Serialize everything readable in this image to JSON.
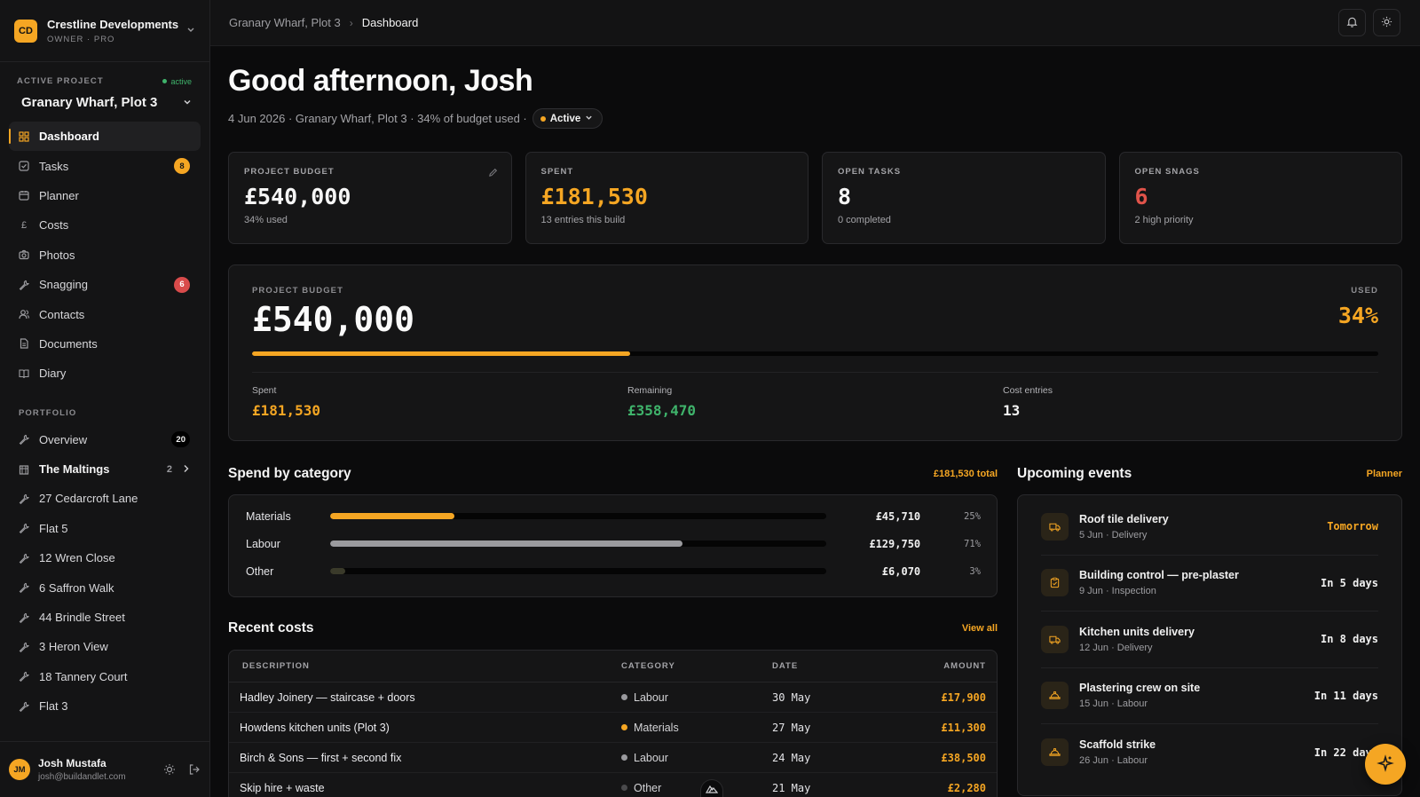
{
  "org": {
    "initials": "CD",
    "name": "Crestline Developments",
    "role": "OWNER · PRO"
  },
  "project": {
    "section_label": "ACTIVE PROJECT",
    "status": "active",
    "name": "Granary Wharf, Plot 3"
  },
  "nav": [
    {
      "label": "Dashboard",
      "icon": "grid-icon"
    },
    {
      "label": "Tasks",
      "icon": "checkbox-icon",
      "badge": "8"
    },
    {
      "label": "Planner",
      "icon": "calendar-icon"
    },
    {
      "label": "Costs",
      "icon": "pound-icon"
    },
    {
      "label": "Photos",
      "icon": "camera-icon"
    },
    {
      "label": "Snagging",
      "icon": "wrench-icon",
      "badge": "6"
    },
    {
      "label": "Contacts",
      "icon": "contacts-icon"
    },
    {
      "label": "Documents",
      "icon": "document-icon"
    },
    {
      "label": "Diary",
      "icon": "book-icon"
    }
  ],
  "portfolio": {
    "label": "PORTFOLIO",
    "overview": {
      "label": "Overview",
      "badge": "20"
    },
    "group": {
      "label": "The Maltings",
      "count": "2"
    },
    "items": [
      "27 Cedarcroft Lane",
      "Flat 5",
      "12 Wren Close",
      "6 Saffron Walk",
      "44 Brindle Street",
      "3 Heron View",
      "18 Tannery Court",
      "Flat 3"
    ]
  },
  "user": {
    "initials": "JM",
    "name": "Josh Mustafa",
    "email": "josh@buildandlet.com"
  },
  "breadcrumb": {
    "parent": "Granary Wharf, Plot 3",
    "current": "Dashboard"
  },
  "header": {
    "greeting": "Good afternoon, Josh",
    "subline": "4 Jun 2026 · Granary Wharf, Plot 3 · 34% of budget used ·",
    "status": "Active"
  },
  "stats": [
    {
      "label": "PROJECT BUDGET",
      "value": "£540,000",
      "sub": "34% used"
    },
    {
      "label": "SPENT",
      "value": "£181,530",
      "sub": "13 entries this build"
    },
    {
      "label": "OPEN TASKS",
      "value": "8",
      "sub": "0 completed"
    },
    {
      "label": "OPEN SNAGS",
      "value": "6",
      "sub": "2 high priority"
    }
  ],
  "budget": {
    "label": "PROJECT BUDGET",
    "value": "£540,000",
    "used_label": "USED",
    "used_pct": "34%",
    "used_fraction": 0.336,
    "spent_label": "Spent",
    "spent": "£181,530",
    "remaining_label": "Remaining",
    "remaining": "£358,470",
    "entries_label": "Cost entries",
    "entries": "13"
  },
  "spend": {
    "title": "Spend by category",
    "total": "£181,530 total",
    "rows": [
      {
        "name": "Materials",
        "amount": "£45,710",
        "pct": "25%",
        "fraction": 0.25,
        "color": "#f5a623"
      },
      {
        "name": "Labour",
        "amount": "£129,750",
        "pct": "71%",
        "fraction": 0.71,
        "color": "#9a9a9e"
      },
      {
        "name": "Other",
        "amount": "£6,070",
        "pct": "3%",
        "fraction": 0.03,
        "color": "#3a3a2a"
      }
    ]
  },
  "costs": {
    "title": "Recent costs",
    "view_all": "View all",
    "headers": [
      "DESCRIPTION",
      "CATEGORY",
      "DATE",
      "AMOUNT"
    ],
    "rows": [
      {
        "desc": "Hadley Joinery — staircase + doors",
        "cat": "Labour",
        "cat_color": "#9a9a9e",
        "date": "30 May",
        "amount": "£17,900"
      },
      {
        "desc": "Howdens kitchen units (Plot 3)",
        "cat": "Materials",
        "cat_color": "#f5a623",
        "date": "27 May",
        "amount": "£11,300"
      },
      {
        "desc": "Birch & Sons — first + second fix",
        "cat": "Labour",
        "cat_color": "#9a9a9e",
        "date": "24 May",
        "amount": "£38,500"
      },
      {
        "desc": "Skip hire + waste",
        "cat": "Other",
        "cat_color": "#4a4a4c",
        "date": "21 May",
        "amount": "£2,280"
      }
    ]
  },
  "events": {
    "title": "Upcoming events",
    "link": "Planner",
    "rows": [
      {
        "title": "Roof tile delivery",
        "sub": "5 Jun · Delivery",
        "when": "Tomorrow",
        "icon": "truck-icon"
      },
      {
        "title": "Building control — pre-plaster",
        "sub": "9 Jun · Inspection",
        "when": "In 5 days",
        "icon": "clipboard-icon"
      },
      {
        "title": "Kitchen units delivery",
        "sub": "12 Jun · Delivery",
        "when": "In 8 days",
        "icon": "truck-icon"
      },
      {
        "title": "Plastering crew on site",
        "sub": "15 Jun · Labour",
        "when": "In 11 days",
        "icon": "hardhat-icon"
      },
      {
        "title": "Scaffold strike",
        "sub": "26 Jun · Labour",
        "when": "In 22 days",
        "icon": "hardhat-icon"
      }
    ]
  }
}
